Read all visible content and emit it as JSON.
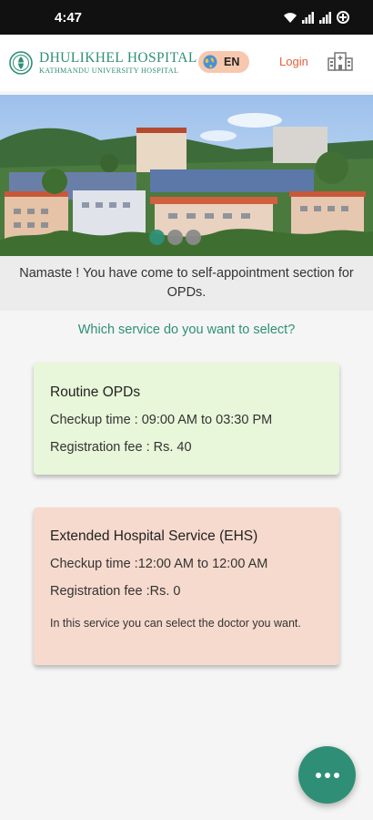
{
  "status_bar": {
    "time": "4:47",
    "icons": [
      "wifi-icon",
      "signal-icon",
      "signal-icon",
      "data-saver-icon"
    ]
  },
  "header": {
    "logo_title": "DHULIKHEL HOSPITAL",
    "logo_subtitle": "KATHMANDU UNIVERSITY HOSPITAL",
    "language_label": "EN",
    "login_label": "Login",
    "brand_color": "#2f8f76",
    "accent_color": "#e2603c"
  },
  "banner": {
    "carousel_pages": 3,
    "active_page": 1
  },
  "intro": {
    "namaste_text": "Namaste ! You have come to self-appointment section for OPDs.",
    "question_text": "Which service do you want to select?"
  },
  "services": [
    {
      "title": "Routine OPDs",
      "checkup_time": "Checkup time : 09:00 AM to 03:30 PM",
      "fee": "Registration fee : Rs. 40",
      "note": "",
      "color": "#e8f6d9"
    },
    {
      "title": "Extended Hospital Service (EHS)",
      "checkup_time": "Checkup time :12:00 AM to 12:00 AM",
      "fee": "Registration fee :Rs. 0",
      "note": "In this service you can select the doctor you want.",
      "color": "#f6dacd"
    }
  ],
  "fab": {
    "icon": "more-horizontal-icon"
  }
}
